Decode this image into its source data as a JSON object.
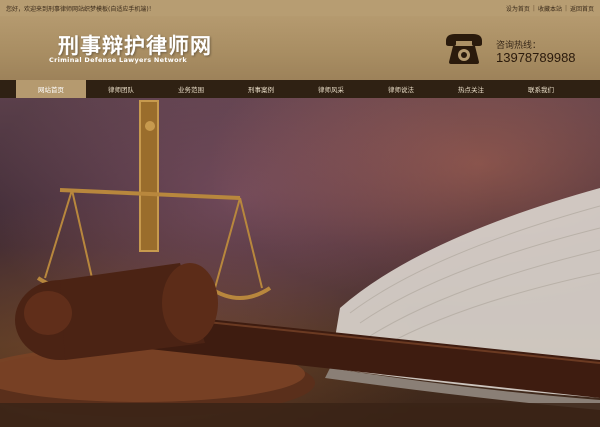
{
  "topbar": {
    "welcome": "您好，欢迎来到刑事律师网站织梦模板(自适应手机端)！",
    "links": [
      "设为首页",
      "收藏本站",
      "返回首页"
    ]
  },
  "header": {
    "title": "刑事辩护律师网",
    "subtitle": "Criminal Defense Lawyers Network",
    "hotline_label": "咨询热线：",
    "hotline_number": "13978789988"
  },
  "nav": {
    "items": [
      "网站首页",
      "律师团队",
      "业务范围",
      "刑事案例",
      "律师风采",
      "律师说法",
      "热点关注",
      "联系我们"
    ],
    "active_index": 0
  },
  "colors": {
    "accent": "#b59a6f",
    "nav_bg": "#2f2113"
  }
}
